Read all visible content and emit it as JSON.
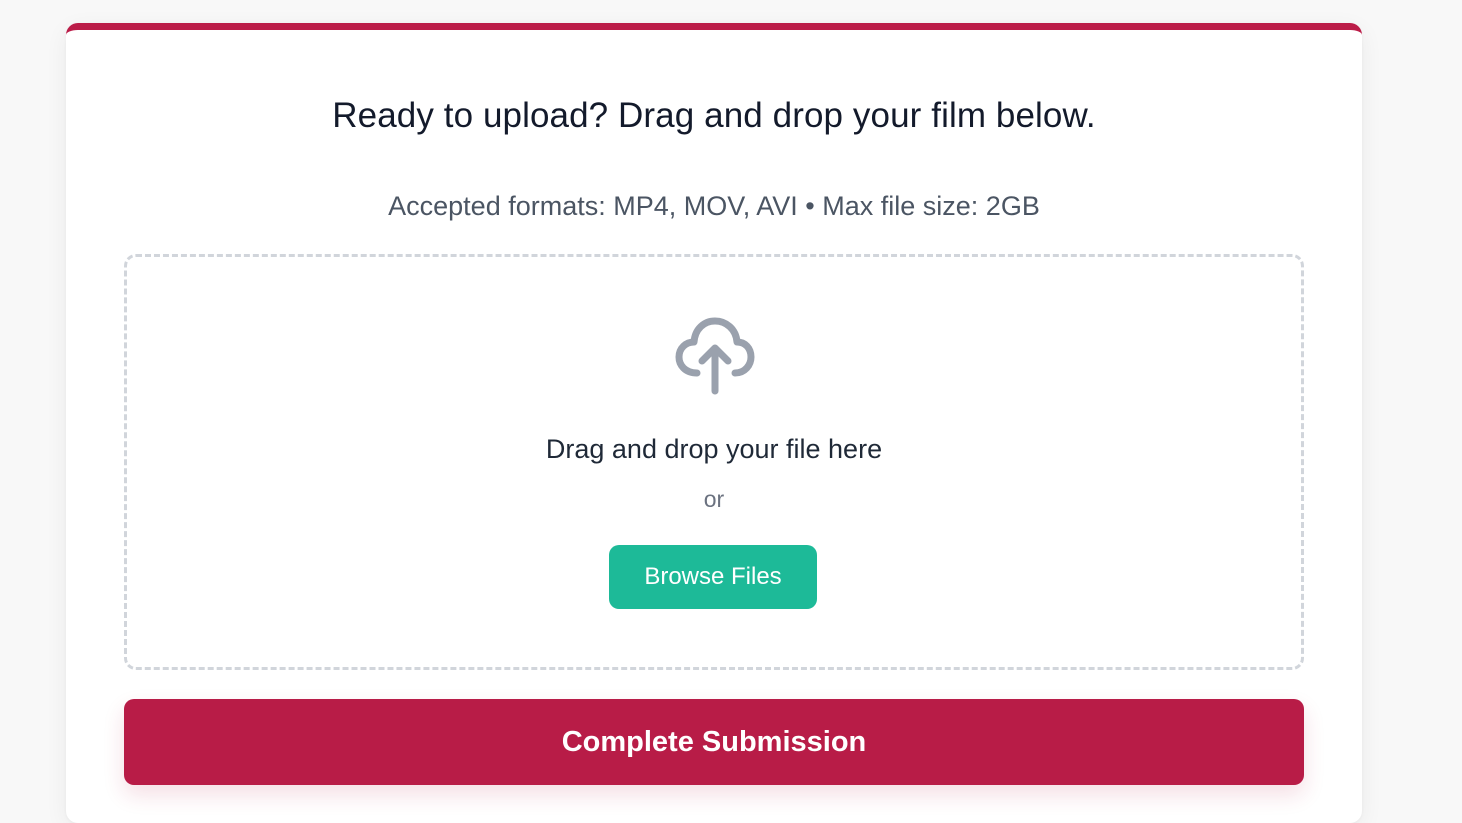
{
  "upload": {
    "title": "Ready to upload? Drag and drop your film below.",
    "formats_text": "Accepted formats: MP4, MOV, AVI • Max file size: 2GB",
    "dropzone": {
      "icon": "cloud-upload-icon",
      "drag_text": "Drag and drop your file here",
      "or_text": "or",
      "browse_label": "Browse Files"
    },
    "submit_label": "Complete Submission"
  },
  "colors": {
    "accent": "#bb1c48",
    "browse_button": "#1dba98",
    "icon": "#9aa1ad",
    "dashed_border": "#d1d5db"
  }
}
